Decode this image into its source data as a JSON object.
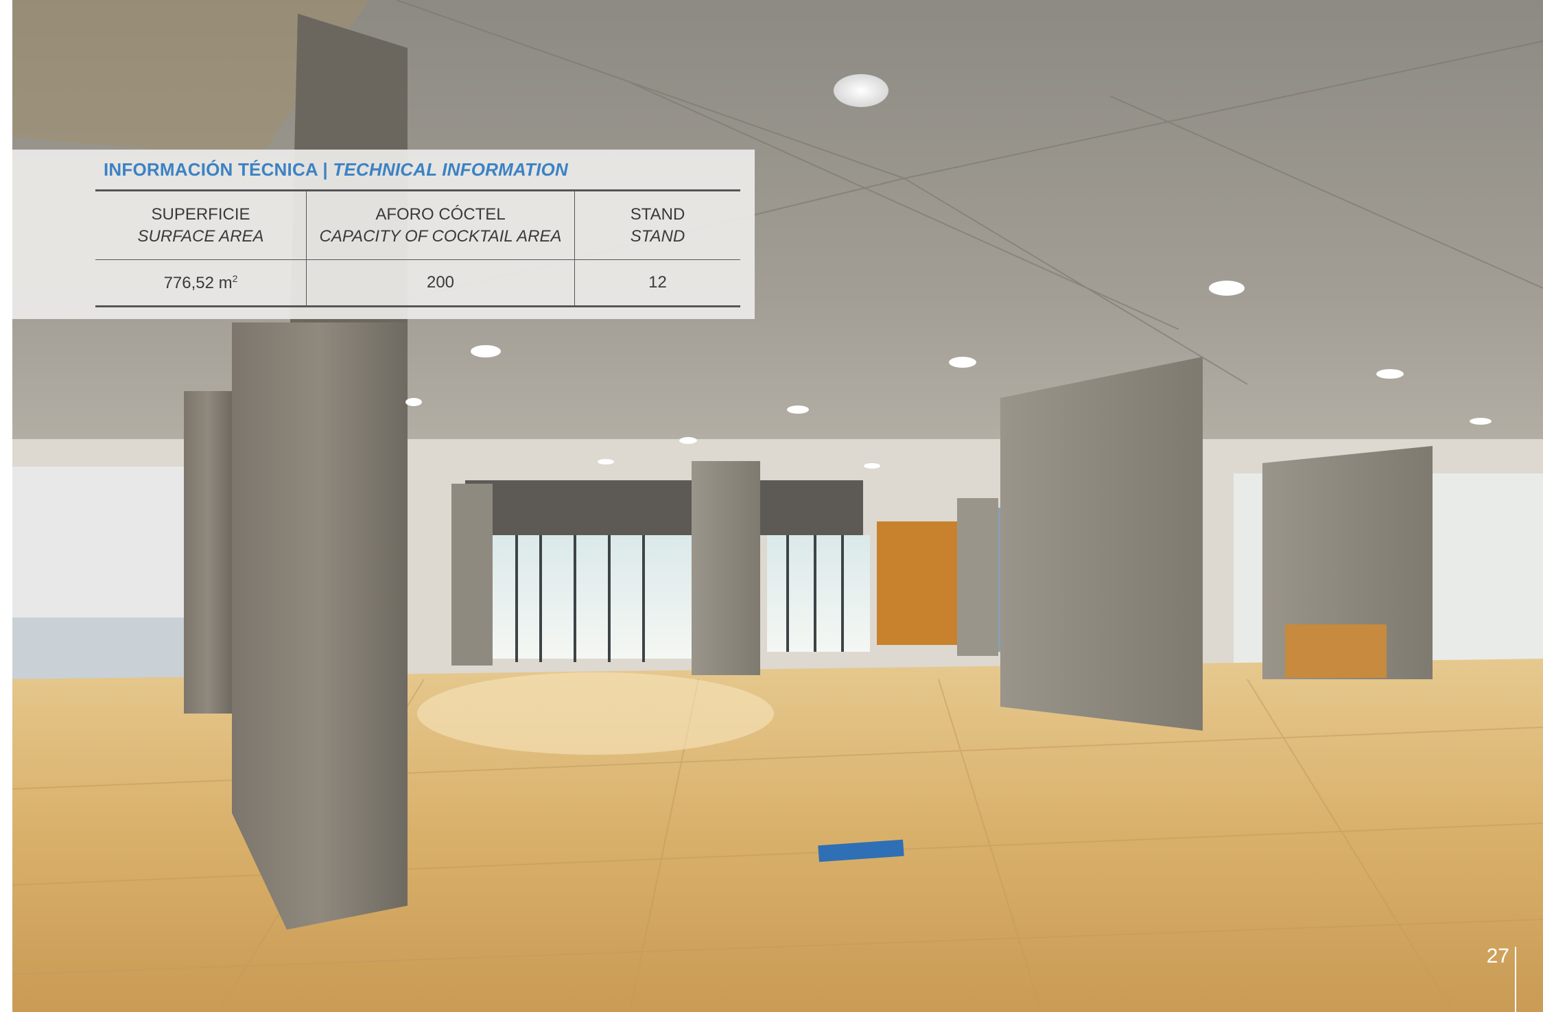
{
  "photo": {
    "description_icon": "venue-lobby-photo",
    "floor_sign_text": ""
  },
  "technical_info": {
    "title_es": "INFORMACIÓN TÉCNICA |",
    "title_en": "TECHNICAL INFORMATION",
    "columns": [
      {
        "label_es": "SUPERFICIE",
        "label_en": "SURFACE AREA"
      },
      {
        "label_es": "AFORO CÓCTEL",
        "label_en": "CAPACITY OF COCKTAIL AREA"
      },
      {
        "label_es": "STAND",
        "label_en": "STAND"
      }
    ],
    "values": {
      "surface": "776,52 m",
      "surface_unit_sup": "2",
      "cocktail": "200",
      "stand": "12"
    },
    "accent_color": "#3b82c4"
  },
  "page": {
    "number": "27"
  }
}
